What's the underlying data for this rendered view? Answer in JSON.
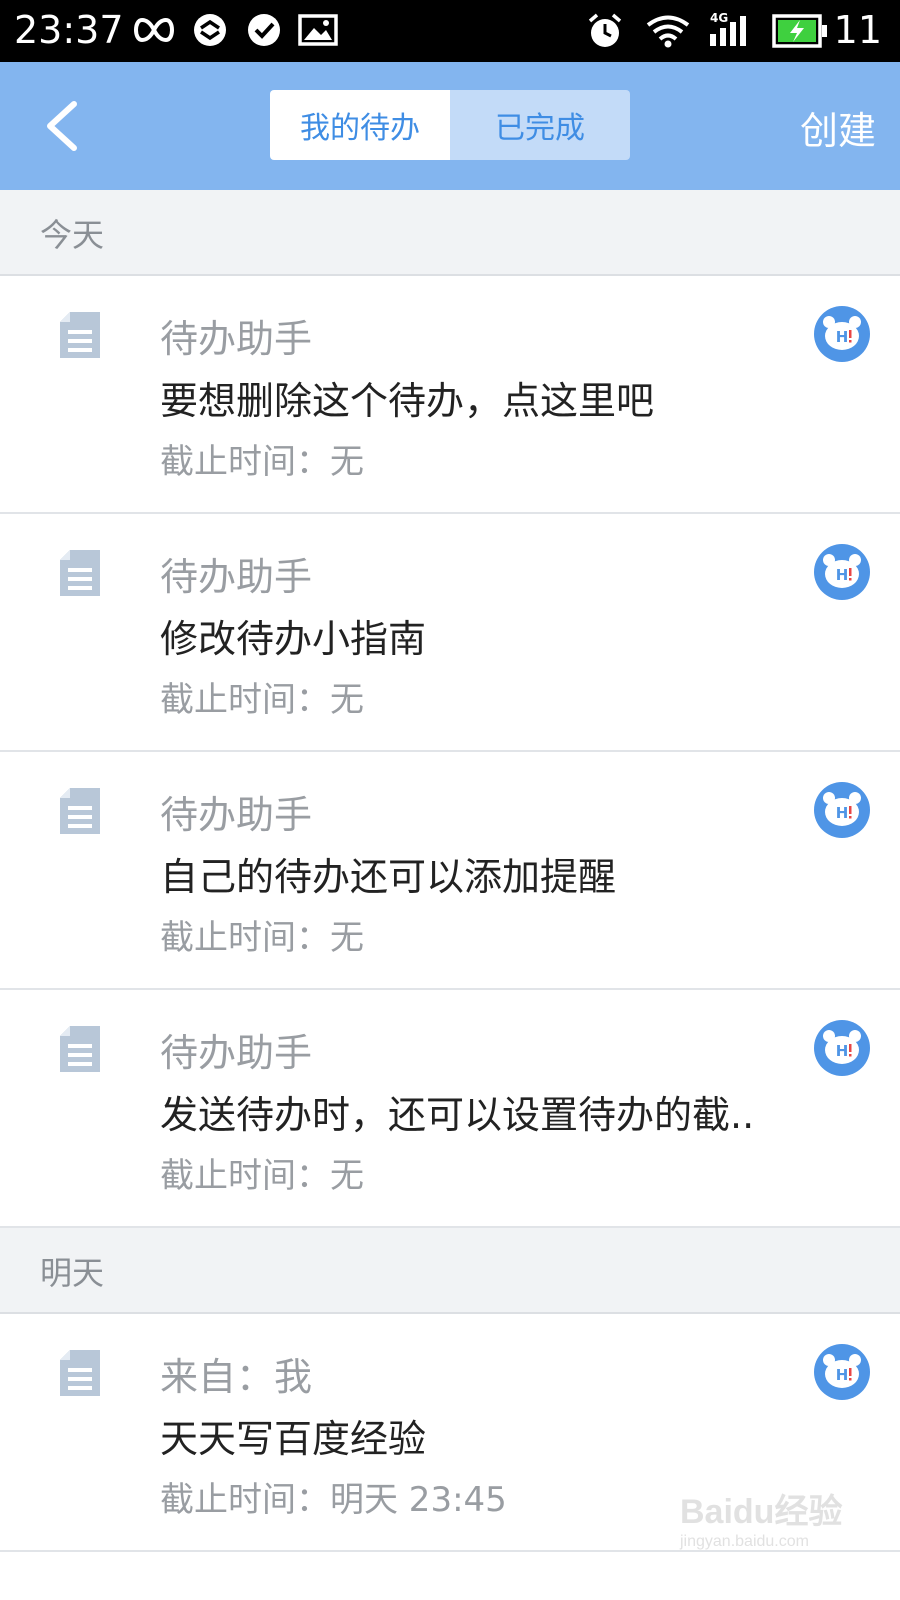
{
  "status_bar": {
    "time": "23:37",
    "battery_level": "11",
    "left_icons": [
      "infinity-icon",
      "sync-icon",
      "check-circle-icon",
      "image-icon"
    ],
    "right_icons": [
      "alarm-icon",
      "wifi-icon",
      "signal-4g-icon",
      "battery-charging-icon"
    ]
  },
  "nav": {
    "back_icon": "chevron-left-icon",
    "tabs": [
      {
        "label": "我的待办",
        "active": true
      },
      {
        "label": "已完成",
        "active": false
      }
    ],
    "create_label": "创建"
  },
  "sections": [
    {
      "header": "今天",
      "items": [
        {
          "from": "待办助手",
          "title": "要想删除这个待办，点这里吧",
          "deadline_label": "截止时间：",
          "deadline_value": "无"
        },
        {
          "from": "待办助手",
          "title": "修改待办小指南",
          "deadline_label": "截止时间：",
          "deadline_value": "无"
        },
        {
          "from": "待办助手",
          "title": "自己的待办还可以添加提醒",
          "deadline_label": "截止时间：",
          "deadline_value": "无"
        },
        {
          "from": "待办助手",
          "title": "发送待办时，还可以设置待办的截..",
          "deadline_label": "截止时间：",
          "deadline_value": "无"
        }
      ]
    },
    {
      "header": "明天",
      "items": [
        {
          "from": "来自：我",
          "title": "天天写百度经验",
          "deadline_label": "截止时间：",
          "deadline_value": "明天 23:45"
        }
      ]
    }
  ],
  "item_icon": "document-icon",
  "avatar_icon": "hi-bear-avatar-icon",
  "colors": {
    "nav_bg": "#83b5ef",
    "accent": "#3f8de4",
    "section_bg": "#f1f3f5",
    "avatar_blue": "#4f95e6"
  },
  "watermark": {
    "line1": "Baidu经验",
    "line2": "jingyan.baidu.com"
  }
}
